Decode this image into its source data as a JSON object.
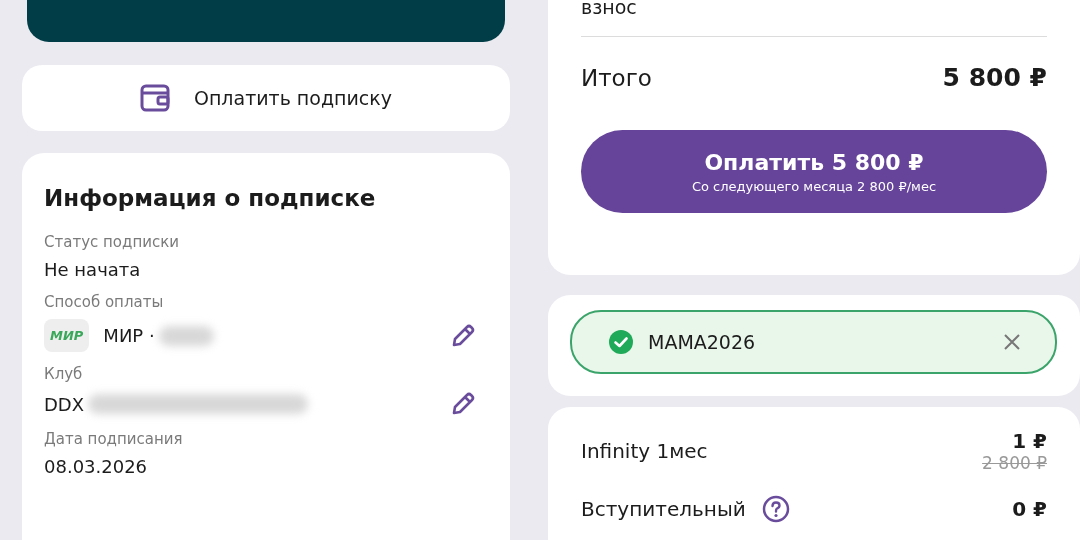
{
  "left": {
    "pay_subscription_button": "Оплатить подписку",
    "info": {
      "title": "Информация о подписке",
      "fields": [
        {
          "kind": "text",
          "label": "Статус подписки",
          "value": "Не начата"
        },
        {
          "kind": "card",
          "label": "Способ оплаты",
          "card_logo": "МИР",
          "value": "МИР ·"
        },
        {
          "kind": "club",
          "label": "Клуб",
          "value": "DDX"
        },
        {
          "kind": "text",
          "label": "Дата подписания",
          "value": "08.03.2026"
        }
      ]
    }
  },
  "right": {
    "fee_label_tail": "взнос",
    "total": {
      "label": "Итого",
      "value": "5 800 ₽"
    },
    "pay_button": {
      "label": "Оплатить 5 800 ₽",
      "sublabel": "Со следующего месяца 2 800 ₽/мес"
    },
    "promo": {
      "code": "MAMA2026",
      "applied": true
    },
    "items": [
      {
        "name": "Infinity 1мес",
        "price": "1 ₽",
        "old_price": "2 800 ₽",
        "help": false
      },
      {
        "name": "Вступительный",
        "price": "0 ₽",
        "help": true
      }
    ]
  }
}
